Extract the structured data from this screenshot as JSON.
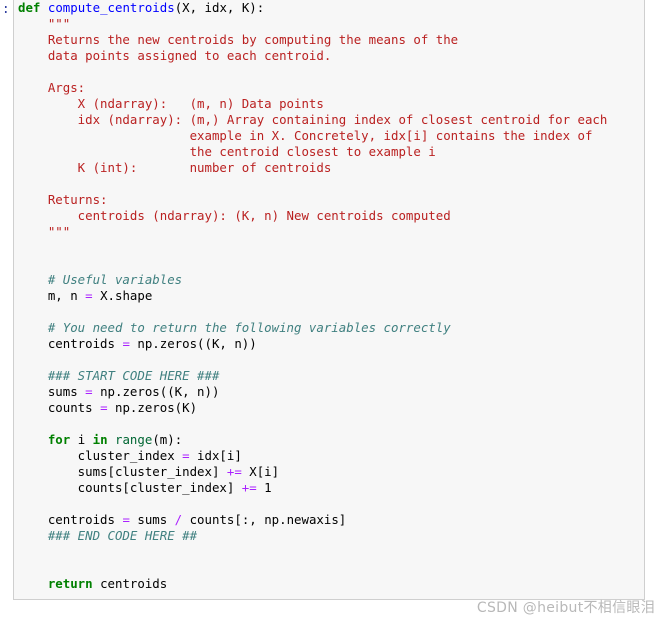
{
  "cell": {
    "prompt": "]:",
    "language": "python",
    "background_color": "#f7f7f7",
    "border_color": "#cfcfcf"
  },
  "colors": {
    "keyword": "#008000",
    "function_name": "#0000ff",
    "builtin": "#006633",
    "string": "#ba2121",
    "comment": "#408080",
    "operator": "#aa22ff",
    "text": "#000000",
    "watermark": "#b8b8b8"
  },
  "code": {
    "title": "compute_centroids",
    "lines": [
      {
        "n": 1,
        "tokens": [
          {
            "t": "kw",
            "v": "def"
          },
          {
            "t": "plain",
            "v": " "
          },
          {
            "t": "fname",
            "v": "compute_centroids"
          },
          {
            "t": "plain",
            "v": "(X, idx, K):"
          }
        ]
      },
      {
        "n": 2,
        "tokens": [
          {
            "t": "str",
            "v": "    \"\"\""
          }
        ]
      },
      {
        "n": 3,
        "tokens": [
          {
            "t": "str",
            "v": "    Returns the new centroids by computing the means of the"
          }
        ]
      },
      {
        "n": 4,
        "tokens": [
          {
            "t": "str",
            "v": "    data points assigned to each centroid."
          }
        ]
      },
      {
        "n": 5,
        "tokens": [
          {
            "t": "str",
            "v": "    "
          }
        ]
      },
      {
        "n": 6,
        "tokens": [
          {
            "t": "str",
            "v": "    Args:"
          }
        ]
      },
      {
        "n": 7,
        "tokens": [
          {
            "t": "str",
            "v": "        X (ndarray):   (m, n) Data points"
          }
        ]
      },
      {
        "n": 8,
        "tokens": [
          {
            "t": "str",
            "v": "        idx (ndarray): (m,) Array containing index of closest centroid for each"
          }
        ]
      },
      {
        "n": 9,
        "tokens": [
          {
            "t": "str",
            "v": "                       example in X. Concretely, idx[i] contains the index of"
          }
        ]
      },
      {
        "n": 10,
        "tokens": [
          {
            "t": "str",
            "v": "                       the centroid closest to example i"
          }
        ]
      },
      {
        "n": 11,
        "tokens": [
          {
            "t": "str",
            "v": "        K (int):       number of centroids"
          }
        ]
      },
      {
        "n": 12,
        "tokens": [
          {
            "t": "str",
            "v": "    "
          }
        ]
      },
      {
        "n": 13,
        "tokens": [
          {
            "t": "str",
            "v": "    Returns:"
          }
        ]
      },
      {
        "n": 14,
        "tokens": [
          {
            "t": "str",
            "v": "        centroids (ndarray): (K, n) New centroids computed"
          }
        ]
      },
      {
        "n": 15,
        "tokens": [
          {
            "t": "str",
            "v": "    \"\"\""
          }
        ]
      },
      {
        "n": 16,
        "tokens": [
          {
            "t": "plain",
            "v": ""
          }
        ]
      },
      {
        "n": 17,
        "tokens": [
          {
            "t": "plain",
            "v": "    "
          }
        ]
      },
      {
        "n": 18,
        "tokens": [
          {
            "t": "com",
            "v": "    # Useful variables"
          }
        ]
      },
      {
        "n": 19,
        "tokens": [
          {
            "t": "plain",
            "v": "    m, n "
          },
          {
            "t": "op",
            "v": "="
          },
          {
            "t": "plain",
            "v": " X.shape"
          }
        ]
      },
      {
        "n": 20,
        "tokens": [
          {
            "t": "plain",
            "v": "    "
          }
        ]
      },
      {
        "n": 21,
        "tokens": [
          {
            "t": "com",
            "v": "    # You need to return the following variables correctly"
          }
        ]
      },
      {
        "n": 22,
        "tokens": [
          {
            "t": "plain",
            "v": "    centroids "
          },
          {
            "t": "op",
            "v": "="
          },
          {
            "t": "plain",
            "v": " np.zeros((K, n))"
          }
        ]
      },
      {
        "n": 23,
        "tokens": [
          {
            "t": "plain",
            "v": "    "
          }
        ]
      },
      {
        "n": 24,
        "tokens": [
          {
            "t": "com",
            "v": "    ### START CODE HERE ###"
          }
        ]
      },
      {
        "n": 25,
        "tokens": [
          {
            "t": "plain",
            "v": "    sums "
          },
          {
            "t": "op",
            "v": "="
          },
          {
            "t": "plain",
            "v": " np.zeros((K, n))"
          }
        ]
      },
      {
        "n": 26,
        "tokens": [
          {
            "t": "plain",
            "v": "    counts "
          },
          {
            "t": "op",
            "v": "="
          },
          {
            "t": "plain",
            "v": " np.zeros(K)"
          }
        ]
      },
      {
        "n": 27,
        "tokens": [
          {
            "t": "plain",
            "v": "    "
          }
        ]
      },
      {
        "n": 28,
        "tokens": [
          {
            "t": "plain",
            "v": "    "
          },
          {
            "t": "kw",
            "v": "for"
          },
          {
            "t": "plain",
            "v": " i "
          },
          {
            "t": "kw",
            "v": "in"
          },
          {
            "t": "plain",
            "v": " "
          },
          {
            "t": "builtin",
            "v": "range"
          },
          {
            "t": "plain",
            "v": "(m):"
          }
        ]
      },
      {
        "n": 29,
        "tokens": [
          {
            "t": "plain",
            "v": "        cluster_index "
          },
          {
            "t": "op",
            "v": "="
          },
          {
            "t": "plain",
            "v": " idx[i]"
          }
        ]
      },
      {
        "n": 30,
        "tokens": [
          {
            "t": "plain",
            "v": "        sums[cluster_index] "
          },
          {
            "t": "op",
            "v": "+="
          },
          {
            "t": "plain",
            "v": " X[i]"
          }
        ]
      },
      {
        "n": 31,
        "tokens": [
          {
            "t": "plain",
            "v": "        counts[cluster_index] "
          },
          {
            "t": "op",
            "v": "+="
          },
          {
            "t": "plain",
            "v": " 1"
          }
        ]
      },
      {
        "n": 32,
        "tokens": [
          {
            "t": "plain",
            "v": "    "
          }
        ]
      },
      {
        "n": 33,
        "tokens": [
          {
            "t": "plain",
            "v": "    centroids "
          },
          {
            "t": "op",
            "v": "="
          },
          {
            "t": "plain",
            "v": " sums "
          },
          {
            "t": "op",
            "v": "/"
          },
          {
            "t": "plain",
            "v": " counts[:, np.newaxis]"
          }
        ]
      },
      {
        "n": 34,
        "tokens": [
          {
            "t": "com",
            "v": "    ### END CODE HERE ##"
          }
        ]
      },
      {
        "n": 35,
        "tokens": [
          {
            "t": "plain",
            "v": "    "
          }
        ]
      },
      {
        "n": 36,
        "tokens": [
          {
            "t": "plain",
            "v": "    "
          }
        ]
      },
      {
        "n": 37,
        "tokens": [
          {
            "t": "plain",
            "v": "    "
          },
          {
            "t": "kw",
            "v": "return"
          },
          {
            "t": "plain",
            "v": " centroids"
          }
        ]
      }
    ]
  },
  "watermark": {
    "text": "CSDN @heibut不相信眼泪"
  }
}
